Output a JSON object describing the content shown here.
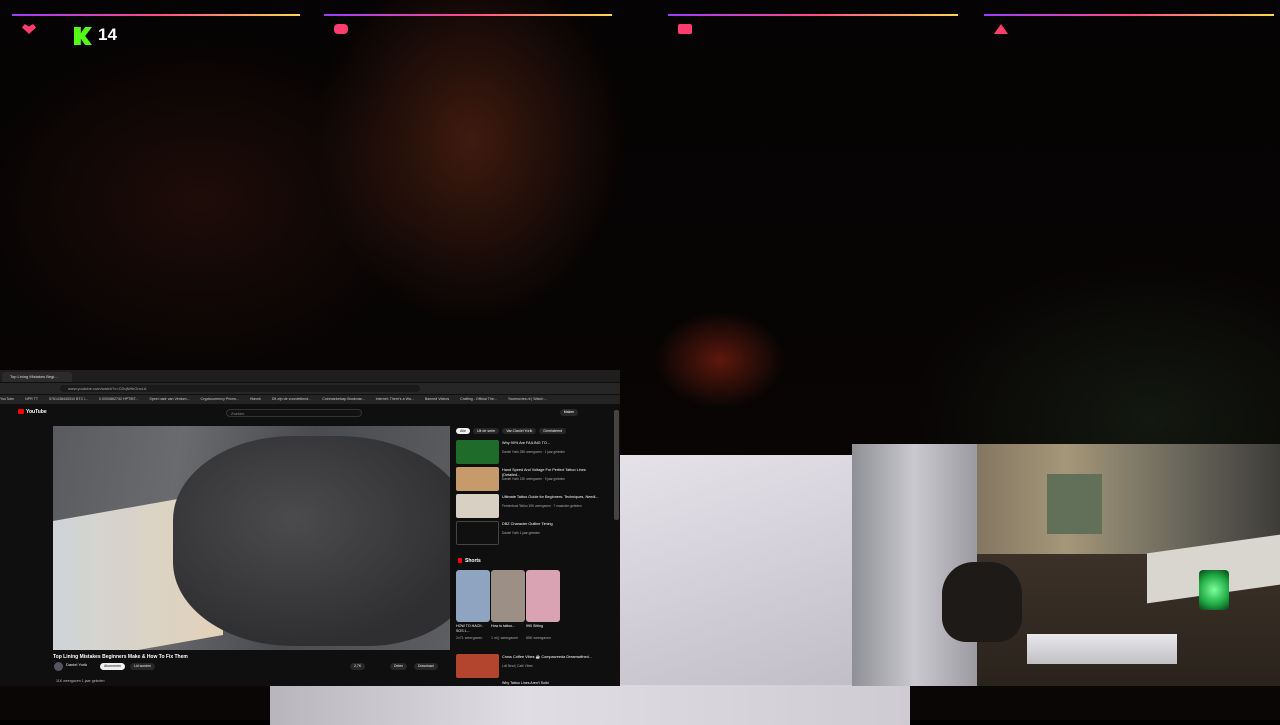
{
  "overlay": {
    "kick_count": "14",
    "accent_colors": [
      "#9a3cff",
      "#ff4a8a",
      "#ffd84a"
    ],
    "kick_color": "#53fc18",
    "icons": [
      "heart-icon",
      "kick-logo-icon",
      "chat-icon",
      "gift-icon",
      "triangle-icon"
    ]
  },
  "browser": {
    "tab_title": "Top Lining Mistakes Begi...",
    "url": "www.youtube.com/watch?v=CDqNHkGnvLA",
    "bookmarks": [
      "YouTube",
      "NPR TT",
      "5761438445310 BTC l...",
      "0.0000862742 HPT/BT...",
      "Speel nadr van Venium...",
      "Cryptocurrency Prices...",
      "Hlavek",
      "Dit zijn de voordelikrnd...",
      "Coinmarketcap Bookmar...",
      "Internet: There's a Wa...",
      "Banned Videos",
      "Crafting - Official The...",
      "Yourmovies.nl | Watch ..."
    ]
  },
  "youtube": {
    "logo": "YouTube",
    "search_placeholder": "Zoeken",
    "make_button": "Maken",
    "video_title": "Top Lining Mistakes Beginners Make & How To Fix Them",
    "channel": "Daniel Yorik",
    "subscribe": "Abonneren",
    "join": "Lid worden",
    "likes": "2,7K",
    "share": "Delen",
    "download": "Download",
    "views_line": "11K weergaven  1 jaar geleden",
    "chips": [
      "Alle",
      "Uit de serie",
      "Van Daniel Yorik",
      "Gerelateerd"
    ],
    "recommendations": [
      {
        "title": "Why 90% Are FAILING TO...",
        "meta": "Daniel Yorik\n25K weergaven · 1 jaar geleden",
        "color": "#1e6b2a"
      },
      {
        "title": "Hand Speed And Voltage For Perfect Tattoo Lines (Detailed...",
        "meta": "Daniel Yorik\n13K weergaven · 9 jaar geleden",
        "color": "#c69a6a"
      },
      {
        "title": "Ultimate Tattoo Guide for Beginners: Techniques, Needl...",
        "meta": "Ferminfood Tattoo\n15K weergaven · 7 maanden geleden",
        "color": "#d8d0c2"
      },
      {
        "title": "DBZ Character Outline Timing",
        "meta": "Daniel Yorik\n1 jaar geleden",
        "color": "#101010"
      }
    ],
    "shorts_heading": "Shorts",
    "shorts": [
      {
        "title": "HOW TO HACK: SOS L...",
        "meta": "2x71 weergaven",
        "color": "#8fa4c0"
      },
      {
        "title": "How to tattoo...",
        "meta": "1 mlj. weergaven",
        "color": "#9b8f86"
      },
      {
        "title": "990 Sitting",
        "meta": "65K weergaven",
        "color": "#d9a3b4"
      }
    ],
    "more_recommendation": {
      "title": "Cross Coffee Vibes ☕ Compacreeda Dreamwithed...",
      "meta": "Lofi Beat | Café Vibes",
      "color": "#b3452e"
    },
    "next_recommendation": {
      "title": "Why Tattoo Lines Aren't Solid"
    }
  }
}
